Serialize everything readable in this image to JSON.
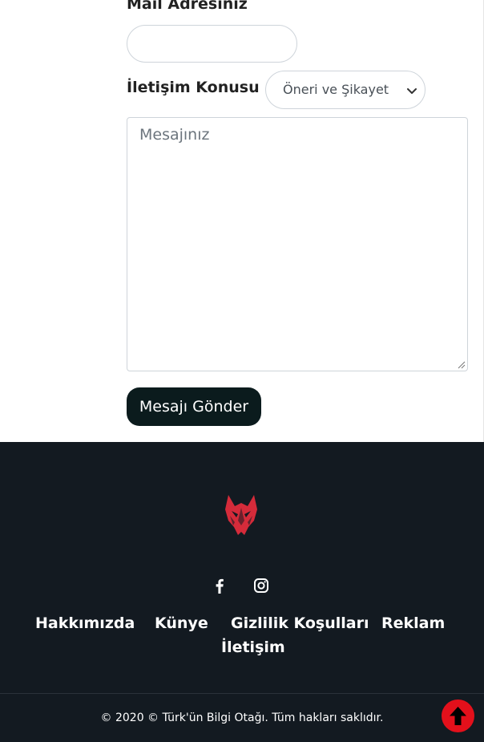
{
  "form": {
    "mail_label": "Mail Adresiniz",
    "mail_value": "",
    "topic_label": "İletişim Konusu",
    "topic_selected": "Öneri ve Şikayet",
    "message_placeholder": "Mesajınız",
    "message_value": "",
    "send_label": "Mesajı Gönder"
  },
  "footer": {
    "logo_icon": "wolf-head-icon",
    "social": [
      "facebook-icon",
      "instagram-icon"
    ],
    "nav": {
      "about": "Hakkımızda",
      "imprint": "Künye",
      "privacy": "Gizlilik Koşulları",
      "ads": "Reklam",
      "contact": "İletişim"
    },
    "copyright": "© 2020 © Türk'ün Bilgi Otağı. Tüm hakları saklıdır."
  },
  "colors": {
    "footer_bg": "#131a21",
    "button_bg": "#0b1b1d",
    "accent_red": "#e3101b",
    "logo_red": "#d52b3a"
  }
}
